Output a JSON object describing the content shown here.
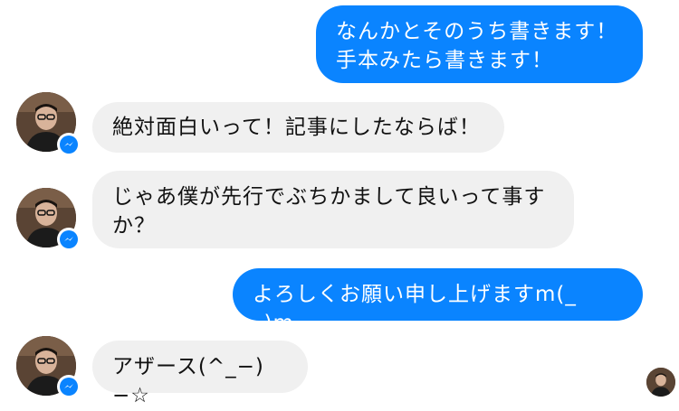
{
  "messages": [
    {
      "direction": "sent",
      "text": "なんかとそのうち書きます！\n手本みたら書きます！"
    },
    {
      "direction": "received",
      "text": "絶対面白いって！記事にしたならば！"
    },
    {
      "direction": "received",
      "text": "じゃあ僕が先行でぶちかまして良いって事す\nか？"
    },
    {
      "direction": "sent",
      "text": "よろしくお願い申し上げますm(_ _)m"
    },
    {
      "direction": "received",
      "text": "アザース(^_−)−☆"
    }
  ],
  "colors": {
    "sent_bubble": "#0a84ff",
    "received_bubble": "#f0f0f0",
    "badge": "#0a84ff"
  },
  "icons": {
    "avatar": "person-photo-avatar",
    "badge": "messenger-icon",
    "read_receipt": "seen-avatar"
  }
}
